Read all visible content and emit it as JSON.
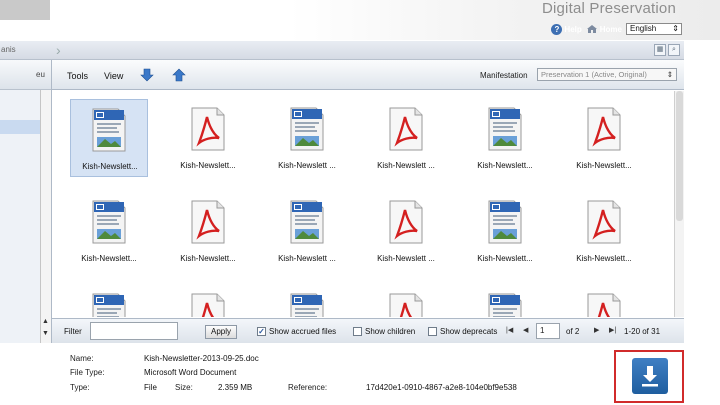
{
  "header": {
    "brand": "Digital Preservation",
    "help_label": "Help",
    "home_label": "Home",
    "language": "English"
  },
  "breadcrumb": {
    "text": "anis"
  },
  "left_panel": {
    "header_label": "eu"
  },
  "toolbar": {
    "tools_label": "Tools",
    "view_label": "View",
    "manifestation_label": "Manifestation",
    "manifestation_value": "Preservation 1 (Active, Original)"
  },
  "files": [
    {
      "name": "Kish-Newslett...",
      "type": "doc"
    },
    {
      "name": "Kish-Newslett...",
      "type": "pdf"
    },
    {
      "name": "Kish-Newslett ...",
      "type": "doc"
    },
    {
      "name": "Kish-Newslett ...",
      "type": "pdf"
    },
    {
      "name": "Kish-Newslett...",
      "type": "doc"
    },
    {
      "name": "Kish-Newslett...",
      "type": "pdf"
    },
    {
      "name": "Kish-Newslett...",
      "type": "doc"
    },
    {
      "name": "Kish-Newslett...",
      "type": "pdf"
    },
    {
      "name": "Kish-Newslett ...",
      "type": "doc"
    },
    {
      "name": "Kish-Newslett ...",
      "type": "pdf"
    },
    {
      "name": "Kish-Newslett...",
      "type": "doc"
    },
    {
      "name": "Kish-Newslett...",
      "type": "pdf"
    },
    {
      "name": "",
      "type": "doc"
    },
    {
      "name": "",
      "type": "pdf"
    },
    {
      "name": "",
      "type": "doc"
    },
    {
      "name": "",
      "type": "pdf"
    },
    {
      "name": "",
      "type": "doc"
    },
    {
      "name": "",
      "type": "pdf"
    }
  ],
  "pager": {
    "filter_label": "Filter",
    "filter_value": "",
    "apply_label": "Apply",
    "show_accrued_label": "Show accrued files",
    "show_accrued_checked": true,
    "show_children_label": "Show children",
    "show_deprecated_label": "Show deprecats",
    "page_value": "1",
    "of_label": "of 2",
    "range_label": "1-20 of 31"
  },
  "details": {
    "name_label": "Name:",
    "name_value": "Kish-Newsletter-2013-09-25.doc",
    "filetype_label": "File Type:",
    "filetype_value": "Microsoft Word Document",
    "type_label": "Type:",
    "type_value": "File",
    "size_label": "Size:",
    "size_value": "2.359 MB",
    "reference_label": "Reference:",
    "reference_value": "17d420e1-0910-4867-a2e8-104e0bf9e538"
  }
}
